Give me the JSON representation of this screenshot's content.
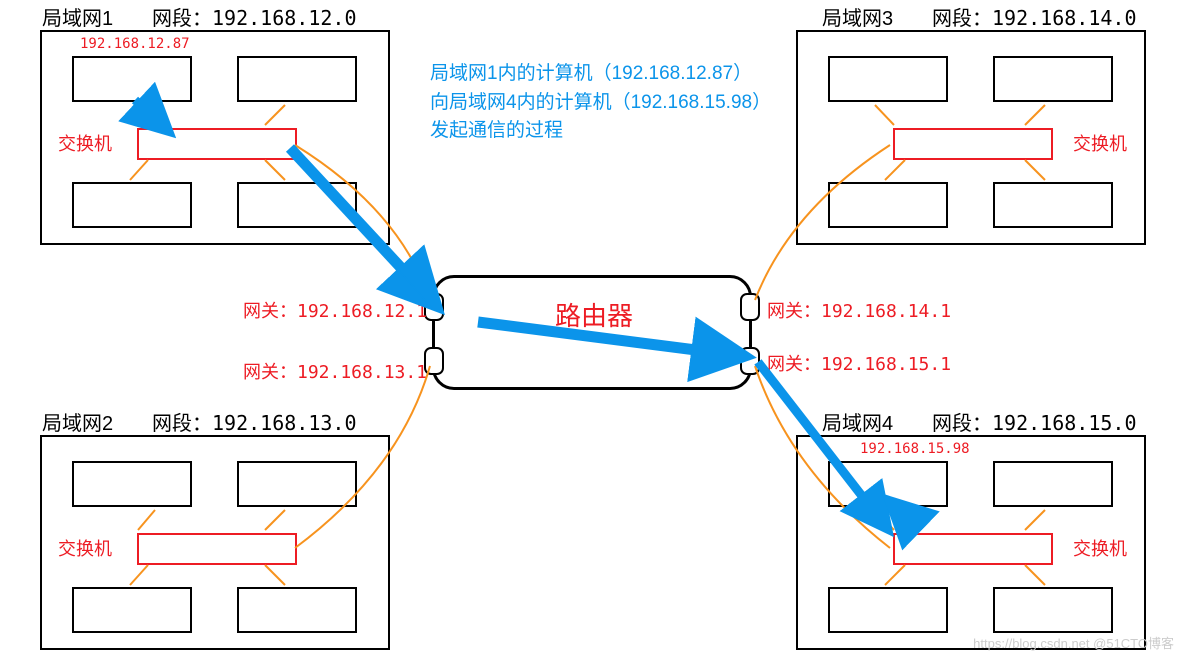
{
  "lans": {
    "lan1": {
      "title": "局域网1",
      "subnet": "网段：192.168.12.0",
      "switch": "交换机",
      "computer_ip": "192.168.12.87"
    },
    "lan2": {
      "title": "局域网2",
      "subnet": "网段：192.168.13.0",
      "switch": "交换机"
    },
    "lan3": {
      "title": "局域网3",
      "subnet": "网段：192.168.14.0",
      "switch": "交换机"
    },
    "lan4": {
      "title": "局域网4",
      "subnet": "网段：192.168.15.0",
      "switch": "交换机",
      "computer_ip": "192.168.15.98"
    }
  },
  "gateways": {
    "g1": "网关：192.168.12.1",
    "g2": "网关：192.168.13.1",
    "g3": "网关：192.168.14.1",
    "g4": "网关：192.168.15.1"
  },
  "router": {
    "label": "路由器"
  },
  "description": {
    "line1": "局域网1内的计算机（192.168.12.87）",
    "line2": "向局域网4内的计算机（192.168.15.98）",
    "line3": "发起通信的过程"
  },
  "watermark": "https://blog.csdn.net @51CTO博客"
}
